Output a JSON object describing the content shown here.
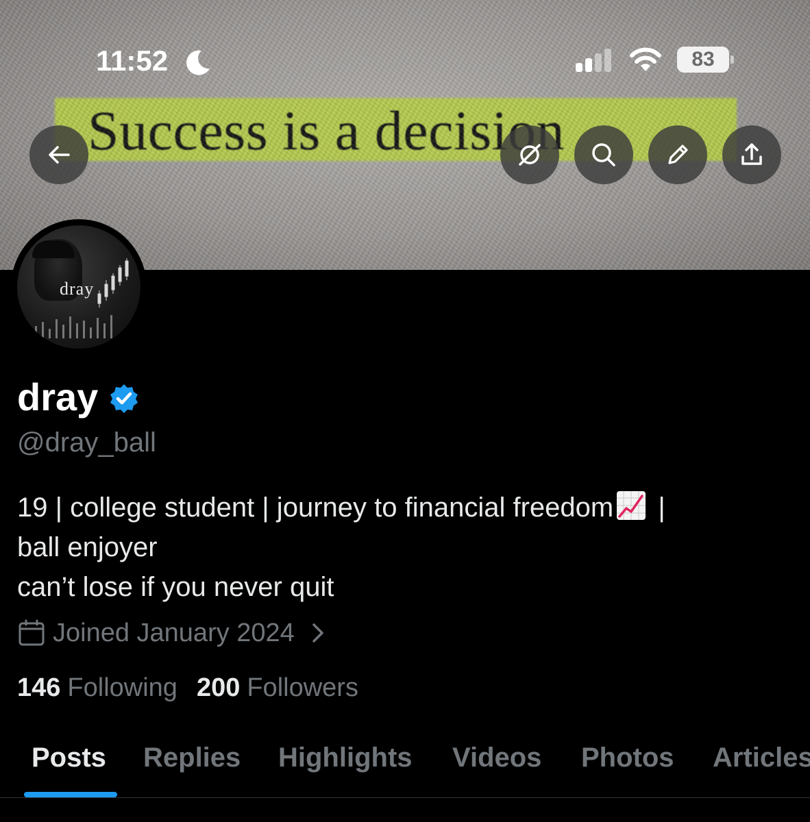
{
  "status_bar": {
    "time": "11:52",
    "battery": "83",
    "icons": [
      "moon-icon",
      "signal-icon",
      "wifi-icon",
      "battery-icon"
    ]
  },
  "banner": {
    "quote": "Success is a decision",
    "highlight_color": "#b7cf49"
  },
  "header_buttons": {
    "icons": [
      "back-arrow-icon",
      "grok-icon",
      "search-icon",
      "pencil-icon",
      "share-icon"
    ]
  },
  "avatar": {
    "name": "dray"
  },
  "profile": {
    "display_name": "dray",
    "verified": true,
    "handle": "@dray_ball",
    "bio": {
      "line1_before": "19 | college student | journey to financial freedom",
      "line1_after": " |",
      "line2": "ball enjoyer",
      "line3": "can’t lose if you never quit"
    },
    "joined": "Joined January 2024",
    "following_count": "146",
    "following_label": "Following",
    "followers_count": "200",
    "followers_label": "Followers"
  },
  "tabs": [
    {
      "label": "Posts",
      "active": true
    },
    {
      "label": "Replies",
      "active": false
    },
    {
      "label": "Highlights",
      "active": false
    },
    {
      "label": "Videos",
      "active": false
    },
    {
      "label": "Photos",
      "active": false
    },
    {
      "label": "Articles",
      "active": false
    }
  ],
  "colors": {
    "background": "#000000",
    "text_primary": "#e7e9ea",
    "text_secondary": "#71767b",
    "accent": "#1d9bf0",
    "verified": "#1d9bf0"
  }
}
